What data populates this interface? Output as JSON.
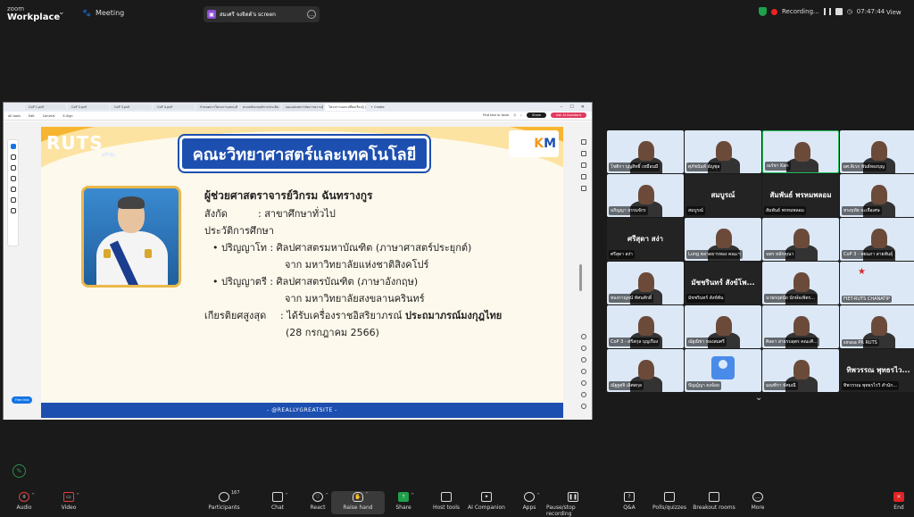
{
  "app": {
    "brand_top": "zoom",
    "brand_bottom": "Workplace",
    "meeting_label": "Meeting"
  },
  "screen_share": {
    "label": "สมเศรี จงจิตต์'s screen"
  },
  "status": {
    "recording": "Recording...",
    "time": "07:47:44",
    "view": "View"
  },
  "pdf": {
    "tabs": [
      "CoP 1.pdf",
      "CoP 2.pdf",
      "CoP 3.pdf",
      "CoP 4.pdf",
      "กำหนดการโครงการแลกเปลี่ยนเรียนรู้...",
      "ตามหลักเกณฑ์การประเมิน 2568-257...",
      "แผนแม่บทการจัดการความรู้ RUS 2...",
      "โครงการแลกเปลี่ยนเรียนรู้ (เอ..."
    ],
    "new_tab": "+ Create",
    "toolbar": [
      "All tools",
      "Edit",
      "Convert",
      "E-Sign"
    ],
    "find": "Find text or tools",
    "share": "Share",
    "ai": "Ask AI Assistant",
    "free_trial": "Free trial"
  },
  "slide": {
    "brand": "RUTS",
    "brand_sub": "ศรีวิชัย",
    "km_left": "K",
    "km_right": "M",
    "faculty": "คณะวิทยาศาสตร์และเทคโนโลยี",
    "name": "ผู้ช่วยศาสตราจารย์วิกรม ฉันทรางกูร",
    "affil_label": "สังกัด",
    "affil_value": ": สาขาศึกษาทั่วไป",
    "edu_label": "ประวัติการศึกษา",
    "edu1_a": "•  ปริญญาโท : ศิลปศาสตรมหาบัณฑิต (ภาษาศาสตร์ประยุกต์)",
    "edu1_b": "จาก มหาวิทยาลัยแห่งชาติสิงคโปร์",
    "edu2_a": "•  ปริญญาตรี : ศิลปศาสตรบัณฑิต (ภาษาอังกฤษ)",
    "edu2_b": "จาก มหาวิทยาลัยสงขลานครินทร์",
    "honor_label": "เกียรติยศสูงสุด",
    "honor_value": ": ได้รับเครื่องราชอิสริยาภรณ์ ",
    "honor_bold": "ประถมาภรณ์มงกุฎไทย",
    "honor_date": "(28 กรกฎาคม 2566)",
    "footer": "- @REALLYGREATSITE -"
  },
  "participants": [
    {
      "label": "โชติกา บุญสิทธิ์ เหมือนมี",
      "big": ""
    },
    {
      "label": "ศุภัชนันท์ อัญชุล",
      "big": ""
    },
    {
      "label": "ณรัชา Kan",
      "big": ""
    },
    {
      "label": "ผศ.ดิเรก พันธ์ทองบุญ",
      "big": ""
    },
    {
      "label": "อภิญญา ธรรมจักร",
      "big": ""
    },
    {
      "label": "สมบูรณ์",
      "big": "สมบูรณ์"
    },
    {
      "label": "สัมพันธ์ พรหมพลอม",
      "big": "สัมพันธ์ พรหมพลอม"
    },
    {
      "label": "ทรงฤทัย จะเจือเศษ",
      "big": ""
    },
    {
      "label": "ศรีสุดา สง่า",
      "big": "ศรีสุดา สง่า"
    },
    {
      "label": "Lung ตลาดธารทอง คณะฯ",
      "big": ""
    },
    {
      "label": "นพร หลักคุณา",
      "big": ""
    },
    {
      "label": "CoP 3 - พยนภา สายพันธุ์",
      "big": ""
    },
    {
      "label": "ทองกาญจน์ ทัศนศักดิ์",
      "big": ""
    },
    {
      "label": "มัชชรินทร์ สังข์พัน",
      "big": "มัชชรินทร์ สังข์โพ..."
    },
    {
      "label": "นายกฤตนัย นักษ์จงจิตร...",
      "big": ""
    },
    {
      "label": "FIET-RUTS CHANATIP",
      "big": ""
    },
    {
      "label": "CoP 3 - ศรีสกุล บุญเรือง",
      "big": ""
    },
    {
      "label": "ณัฐณิชา ทองสมศรี",
      "big": ""
    },
    {
      "label": "ศิลดา สาธรบลุตร คณะศิ...",
      "big": ""
    },
    {
      "label": "sirasa PR RUTS",
      "big": ""
    },
    {
      "label": "ณัฐฐศุจิ เลิศสกุล",
      "big": ""
    },
    {
      "label": "ปัญญ์ญา ตงจ้อย",
      "big": ""
    },
    {
      "label": "มณฑิรา ทัศมณี",
      "big": ""
    },
    {
      "label": "ทิพวรรณ พุทธรไรวิ สำนัก...",
      "big": "ทิพวรรณ พุทธรไว..."
    }
  ],
  "toolbar": {
    "audio": "Audio",
    "video": "Video",
    "participants": "Participants",
    "participants_count": "167",
    "chat": "Chat",
    "react": "React",
    "raise": "Raise hand",
    "share": "Share",
    "host": "Host tools",
    "ai": "AI Companion",
    "apps": "Apps",
    "record": "Pause/stop recording",
    "qa": "Q&A",
    "polls": "Polls/quizzes",
    "breakout": "Breakout rooms",
    "more": "More",
    "end": "End"
  }
}
